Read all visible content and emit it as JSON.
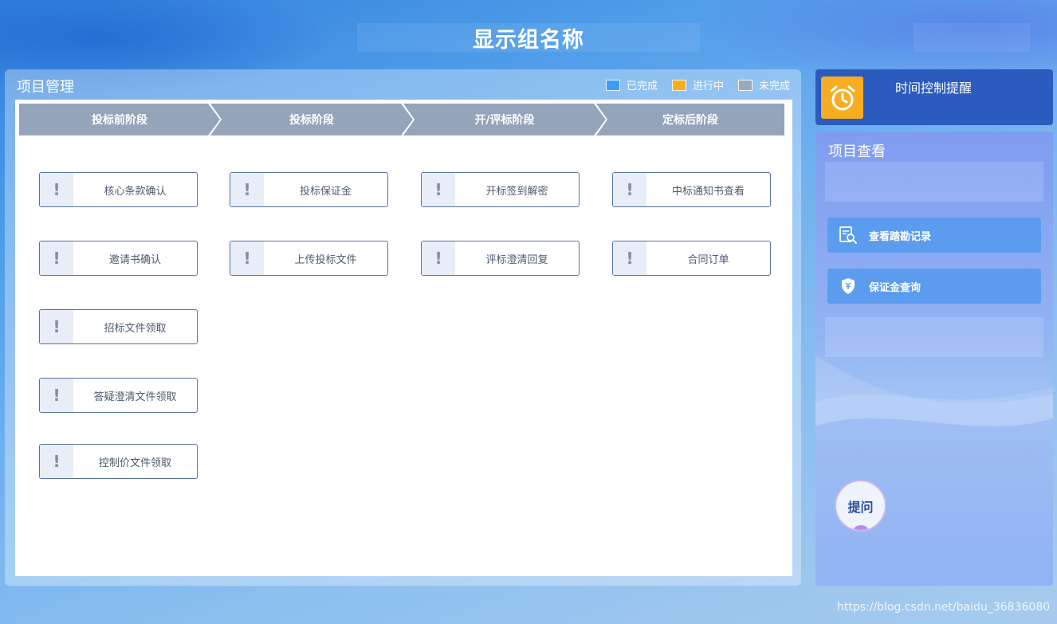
{
  "header": {
    "title": "显示组名称"
  },
  "project_management": {
    "title": "项目管理",
    "legend": [
      {
        "label": "已完成",
        "color": "#3b9cf2"
      },
      {
        "label": "进行中",
        "color": "#f6ad21"
      },
      {
        "label": "未完成",
        "color": "#9ba8bd"
      }
    ],
    "stages": [
      {
        "label": "投标前阶段"
      },
      {
        "label": "投标阶段"
      },
      {
        "label": "开/评标阶段"
      },
      {
        "label": "定标后阶段"
      }
    ],
    "stage_color": "#94a4bb",
    "task_icon": "exclamation-icon",
    "tasks": {
      "col1": [
        "核心条款确认",
        "邀请书确认",
        "招标文件领取",
        "答疑澄清文件领取",
        "控制价文件领取"
      ],
      "col2": [
        "投标保证金",
        "上传投标文件"
      ],
      "col3": [
        "开标签到解密",
        "评标澄清回复"
      ],
      "col4": [
        "中标通知书查看",
        "合同订单"
      ]
    },
    "status_icon": "!"
  },
  "reminder": {
    "title": "时间控制提醒",
    "icon": "alarm-clock-icon",
    "color": "#f6ad21"
  },
  "project_view": {
    "title": "项目查看",
    "buttons": [
      {
        "label": "查看踏勘记录",
        "icon": "document-search-icon"
      },
      {
        "label": "保证金查询",
        "icon": "yuan-shield-icon"
      }
    ]
  },
  "ask": {
    "label": "提问"
  },
  "watermark": "https://blog.csdn.net/baidu_36836080"
}
